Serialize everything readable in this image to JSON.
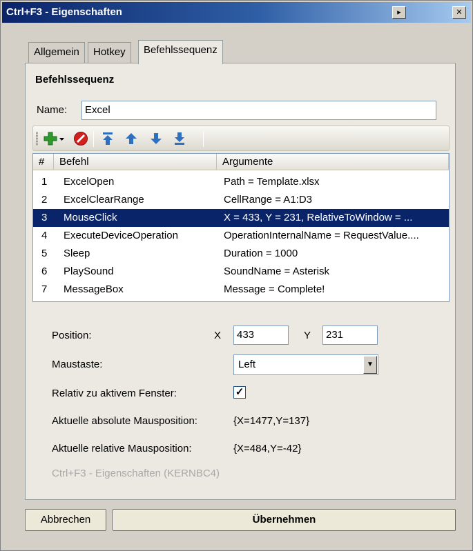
{
  "window": {
    "title": "Ctrl+F3 - Eigenschaften"
  },
  "tabs": [
    {
      "label": "Allgemein"
    },
    {
      "label": "Hotkey"
    },
    {
      "label": "Befehlssequenz"
    }
  ],
  "panel": {
    "heading": "Befehlssequenz",
    "name_label": "Name:",
    "name_value": "Excel"
  },
  "toolbar": {
    "icons": [
      "add-icon",
      "dropdown-arrow-icon",
      "delete-icon",
      "move-top-icon",
      "move-up-icon",
      "move-down-icon",
      "move-bottom-icon"
    ]
  },
  "table": {
    "columns": [
      "#",
      "Befehl",
      "Argumente"
    ],
    "rows": [
      {
        "num": "1",
        "command": "ExcelOpen",
        "args": "Path = Template.xlsx"
      },
      {
        "num": "2",
        "command": "ExcelClearRange",
        "args": "CellRange = A1:D3"
      },
      {
        "num": "3",
        "command": "MouseClick",
        "args": "X = 433, Y = 231, RelativeToWindow = ..."
      },
      {
        "num": "4",
        "command": "ExecuteDeviceOperation",
        "args": "OperationInternalName = RequestValue...."
      },
      {
        "num": "5",
        "command": "Sleep",
        "args": "Duration = 1000"
      },
      {
        "num": "6",
        "command": "PlaySound",
        "args": "SoundName = Asterisk"
      },
      {
        "num": "7",
        "command": "MessageBox",
        "args": "Message = Complete!"
      }
    ],
    "selected_row": 3
  },
  "props": {
    "position_label": "Position:",
    "x_label": "X",
    "x_value": "433",
    "y_label": "Y",
    "y_value": "231",
    "button_label": "Maustaste:",
    "button_value": "Left",
    "relative_label": "Relativ zu aktivem Fenster:",
    "relative_checked": true,
    "abs_label": "Aktuelle absolute Mausposition:",
    "abs_value": "{X=1477,Y=137}",
    "rel_label": "Aktuelle relative Mausposition:",
    "rel_value": "{X=484,Y=-42}",
    "footer_note": "Ctrl+F3 - Eigenschaften (KERNBC4)"
  },
  "buttons": {
    "cancel": "Abbrechen",
    "apply": "Übernehmen"
  },
  "colors": {
    "selection": "#0a246a",
    "title_gradient_start": "#0a246a",
    "add_icon": "#2e9a2e",
    "delete_icon": "#d2201c",
    "arrow_icon": "#2f6fbf"
  }
}
